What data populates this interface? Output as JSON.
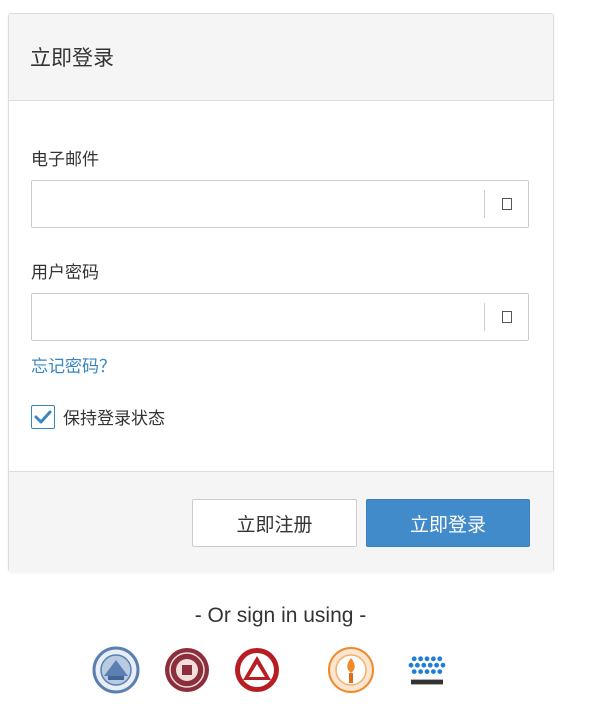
{
  "login": {
    "title": "立即登录",
    "email_label": "电子邮件",
    "email_value": "",
    "password_label": "用户密码",
    "password_value": "",
    "forgot_link": "忘记密码？",
    "remember_label": "保持登录状态",
    "remember_checked": true,
    "register_button": "立即注册",
    "login_button": "立即登录"
  },
  "alt_signin": {
    "text": "- Or sign in using -",
    "providers": [
      {
        "icon": "university-logo-1",
        "color": "#5a7fb0"
      },
      {
        "icon": "university-logo-2",
        "color": "#8b2f3c"
      },
      {
        "icon": "university-logo-3",
        "color": "#b81d24"
      },
      {
        "icon": "university-logo-4",
        "color": "#f08a2a"
      },
      {
        "icon": "university-logo-5",
        "color": "#1f7fd6"
      }
    ]
  },
  "colors": {
    "accent": "#428bca",
    "link": "#3a86c5"
  }
}
